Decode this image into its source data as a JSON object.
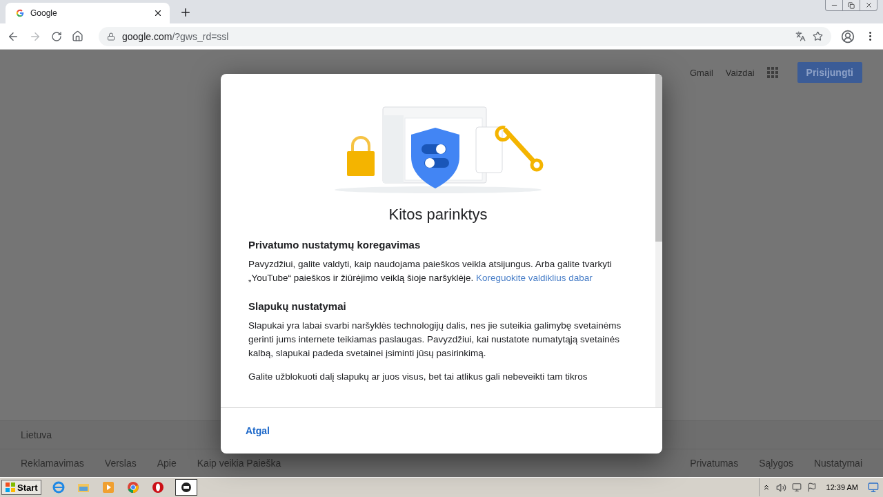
{
  "browser": {
    "tab": {
      "title": "Google",
      "selected": true
    },
    "address": {
      "host": "google.com",
      "path": "/?gws_rd=ssl"
    }
  },
  "page": {
    "header_links": [
      "Gmail",
      "Vaizdai"
    ],
    "sign_in": "Prisijungti",
    "country": "Lietuva",
    "footer_left": [
      "Reklamavimas",
      "Verslas",
      "Apie",
      "Kaip veikia Paieška"
    ],
    "footer_right": [
      "Privatumas",
      "Sąlygos",
      "Nustatymai"
    ]
  },
  "dialog": {
    "title": "Kitos parinktys",
    "sections": [
      {
        "heading": "Privatumo nustatymų koregavimas",
        "paragraphs": [
          {
            "text": "Pavyzdžiui, galite valdyti, kaip naudojama paieškos veikla atsijungus. Arba galite tvarkyti „YouTube“ paieškos ir žiūrėjimo veiklą šioje naršyklėje.",
            "link": "Koreguokite valdiklius dabar"
          }
        ]
      },
      {
        "heading": "Slapukų nustatymai",
        "paragraphs": [
          {
            "text": "Slapukai yra labai svarbi naršyklės technologijų dalis, nes jie suteikia galimybę svetainėms gerinti jums internete teikiamas paslaugas. Pavyzdžiui, kai nustatote numatytąją svetainės kalbą, slapukai padeda svetainei įsiminti jūsų pasirinkimą."
          },
          {
            "text": "Galite užblokuoti dalį slapukų ar juos visus, bet tai atlikus gali nebeveikti tam tikros"
          }
        ]
      }
    ],
    "back_button": "Atgal"
  },
  "taskbar": {
    "start": "Start",
    "time": "12:39 AM"
  }
}
